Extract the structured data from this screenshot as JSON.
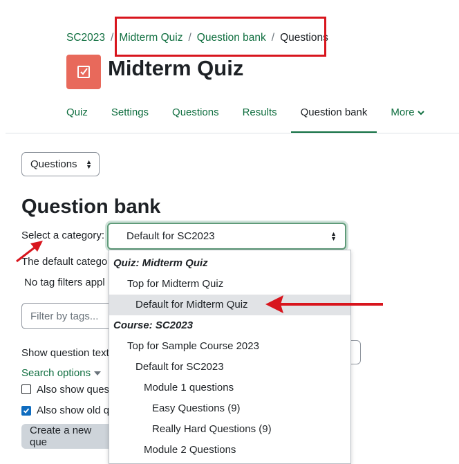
{
  "breadcrumb": [
    "SC2023",
    "Midterm Quiz",
    "Question bank",
    "Questions"
  ],
  "breadcrumb_separator": "/",
  "page_title": "Midterm Quiz",
  "quiz_icon": "quiz-checkbox-icon",
  "nav": {
    "items": [
      "Quiz",
      "Settings",
      "Questions",
      "Results",
      "Question bank",
      "More"
    ],
    "active": "Question bank"
  },
  "questions_select": {
    "value": "Questions"
  },
  "heading": "Question bank",
  "category": {
    "label": "Select a category:",
    "selected": "Default for SC2023"
  },
  "partial_texts": {
    "default_category": "The default catego",
    "tag_filters": "No tag filters appl",
    "show_question_text": "Show question text",
    "search_options": "Search options",
    "also_show_1": "Also show quest",
    "also_show_2": "Also show old q",
    "create_button": "Create a new que"
  },
  "filter": {
    "placeholder": "Filter by tags..."
  },
  "checkboxes": {
    "also_show_1_checked": false,
    "also_show_2_checked": true
  },
  "dropdown_options": [
    {
      "label": "Quiz: Midterm Quiz",
      "group": true,
      "level": 0
    },
    {
      "label": "Top for Midterm Quiz",
      "group": false,
      "level": 1
    },
    {
      "label": "Default for Midterm Quiz",
      "group": false,
      "level": 2,
      "highlighted": true
    },
    {
      "label": "Course: SC2023",
      "group": true,
      "level": 0
    },
    {
      "label": "Top for Sample Course 2023",
      "group": false,
      "level": 1
    },
    {
      "label": "Default for SC2023",
      "group": false,
      "level": 2
    },
    {
      "label": "Module 1 questions",
      "group": false,
      "level": 3
    },
    {
      "label": "Easy Questions (9)",
      "group": false,
      "level": 4
    },
    {
      "label": "Really Hard Questions (9)",
      "group": false,
      "level": 4
    },
    {
      "label": "Module 2 Questions",
      "group": false,
      "level": 3
    }
  ],
  "colors": {
    "link": "#0f6e3f",
    "quiz_icon_bg": "#e8695b",
    "annotation_red": "#d8151d",
    "highlight_row": "#e1e3e6",
    "checkbox_checked": "#0f6cbf"
  }
}
